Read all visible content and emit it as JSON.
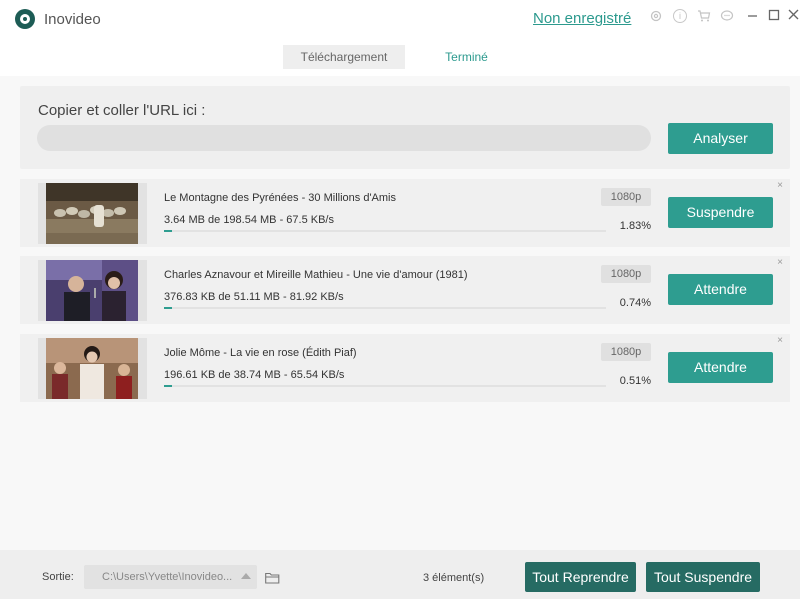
{
  "app": {
    "name": "Inovideo",
    "register_link": "Non enregistré",
    "toolbar_icons": [
      "gear-icon",
      "info-icon",
      "cart-icon",
      "chat-icon"
    ],
    "window_controls": [
      "minimize",
      "maximize",
      "close"
    ]
  },
  "tabs": [
    {
      "label": "Téléchargement",
      "active": false
    },
    {
      "label": "Terminé",
      "active": true
    }
  ],
  "url_panel": {
    "label": "Copier et coller l'URL ici :",
    "input_value": "",
    "button": "Analyser"
  },
  "downloads": [
    {
      "title": "Le Montagne des Pyrénées - 30 Millions d'Amis",
      "progress_text": "3.64 MB de 198.54 MB - 67.5 KB/s",
      "percent": "1.83%",
      "quality": "1080p",
      "action": "Suspendre",
      "close": "×",
      "thumbnail": "sheep-flock-thumbnail"
    },
    {
      "title": "Charles Aznavour et Mireille Mathieu - Une vie d'amour (1981)",
      "progress_text": "376.83 KB de 51.11 MB - 81.92 KB/s",
      "percent": "0.74%",
      "quality": "1080p",
      "action": "Attendre",
      "close": "×",
      "thumbnail": "singers-duet-thumbnail"
    },
    {
      "title": "Jolie Môme - La vie en rose (Édith Piaf)",
      "progress_text": "196.61 KB de 38.74 MB - 65.54 KB/s",
      "percent": "0.51%",
      "quality": "1080p",
      "action": "Attendre",
      "close": "×",
      "thumbnail": "group-performance-thumbnail"
    }
  ],
  "footer": {
    "output_label": "Sortie:",
    "output_path": "C:\\Users\\Yvette\\Inovideo...",
    "count": "3 élément(s)",
    "resume_all": "Tout Reprendre",
    "suspend_all": "Tout Suspendre"
  },
  "colors": {
    "accent": "#2e9d90",
    "accent_dark": "#266b63",
    "link": "#2c9a8e"
  }
}
